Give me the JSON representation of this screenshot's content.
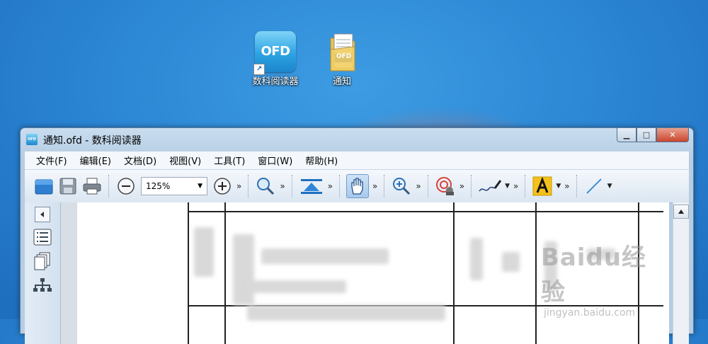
{
  "desktop": {
    "icons": [
      {
        "label": "数科阅读器",
        "glyph": "OFD"
      },
      {
        "label": "通知",
        "glyph": "OFD"
      }
    ]
  },
  "window": {
    "title": "通知.ofd - 数科阅读器",
    "app_icon_text": "OFD",
    "buttons": {
      "minimize": "▁",
      "maximize": "□",
      "close": "✕"
    }
  },
  "menu": {
    "items": [
      "文件(F)",
      "编辑(E)",
      "文档(D)",
      "视图(V)",
      "工具(T)",
      "窗口(W)",
      "帮助(H)"
    ]
  },
  "toolbar": {
    "zoom_value": "125%",
    "more_glyph": "»",
    "caret_glyph": "▼"
  },
  "document": {
    "watermark_main": "Baidu经验",
    "watermark_sub": "jingyan.baidu.com"
  },
  "colors": {
    "desktop_blue": "#2a84d2",
    "accent_blue": "#1c86cc",
    "close_red": "#c9462c"
  }
}
